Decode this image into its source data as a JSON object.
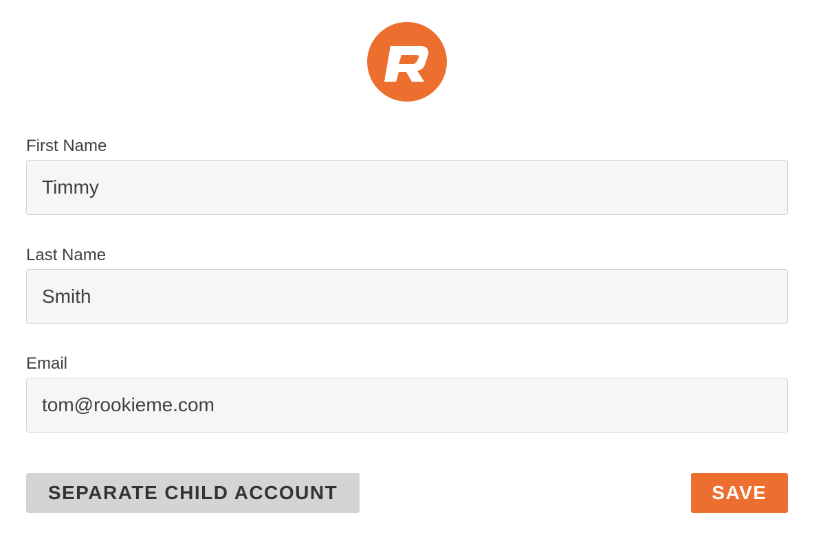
{
  "logo": {
    "icon": "rookieme-r-logo",
    "letter": "R",
    "background": "#ec6f2f",
    "foreground": "#ffffff"
  },
  "form": {
    "first_name": {
      "label": "First Name",
      "value": "Timmy"
    },
    "last_name": {
      "label": "Last Name",
      "value": "Smith"
    },
    "email": {
      "label": "Email",
      "value": "tom@rookieme.com"
    }
  },
  "actions": {
    "separate_label": "SEPARATE CHILD ACCOUNT",
    "save_label": "SAVE"
  },
  "colors": {
    "accent": "#ec6f2f",
    "secondary_button": "#d4d4d4",
    "input_background": "#f6f6f6",
    "input_border": "#d6d6d6",
    "text": "#3f3f3f"
  }
}
